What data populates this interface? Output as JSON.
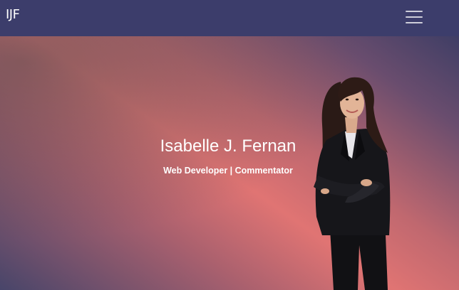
{
  "navbar": {
    "brand": "IJF",
    "menu_icon": "hamburger-menu-icon"
  },
  "hero": {
    "name": "Isabelle J. Fernan",
    "tagline": "Web Developer | Commentator",
    "colors": {
      "navbar": "#3c3d6b",
      "gradient_dark": "#48456a",
      "gradient_coral": "#e07473",
      "gradient_navy": "#3f3e65",
      "text": "#ffffff"
    }
  }
}
